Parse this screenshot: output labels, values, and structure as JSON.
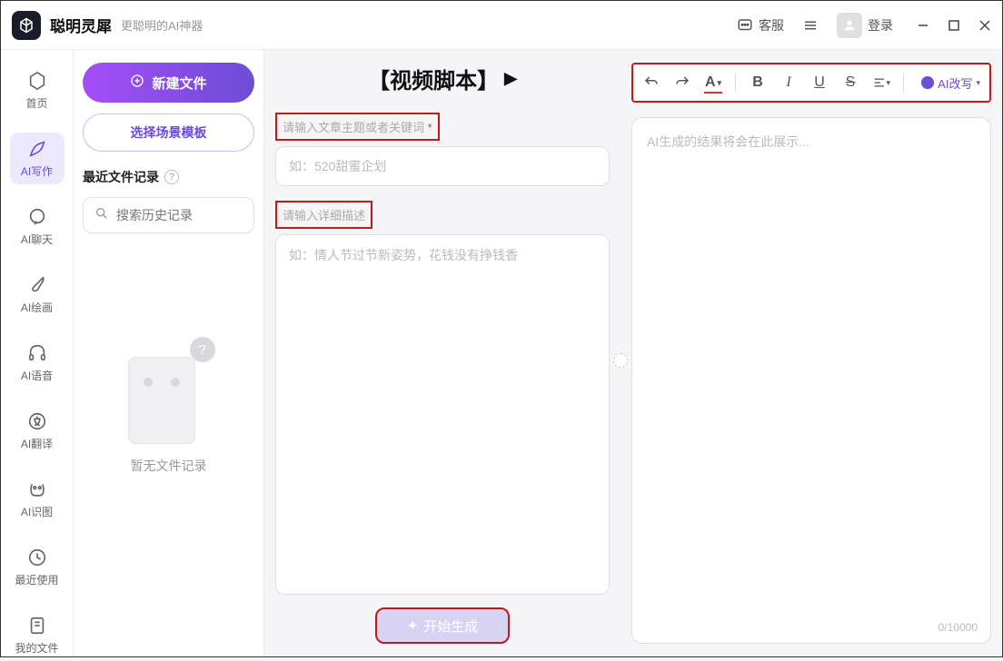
{
  "titlebar": {
    "app_name": "聪明灵犀",
    "app_subtitle": "更聪明的AI神器",
    "service_label": "客服",
    "login_label": "登录"
  },
  "sidebar": {
    "items": [
      {
        "label": "首页"
      },
      {
        "label": "AI写作"
      },
      {
        "label": "AI聊天"
      },
      {
        "label": "AI绘画"
      },
      {
        "label": "AI语音"
      },
      {
        "label": "AI翻译"
      },
      {
        "label": "AI识图"
      },
      {
        "label": "最近使用"
      },
      {
        "label": "我的文件"
      }
    ]
  },
  "leftpanel": {
    "new_file": "新建文件",
    "choose_template": "选择场景模板",
    "recent_title": "最近文件记录",
    "search_placeholder": "搜索历史记录",
    "empty_text": "暂无文件记录"
  },
  "center": {
    "title": "【视频脚本】",
    "topic_label": "请输入文章主题或者关键词",
    "topic_placeholder": "如：520甜蜜企划",
    "desc_label": "请输入详细描述",
    "desc_placeholder": "如：情人节过节新姿势，花钱没有挣钱香",
    "generate": "开始生成"
  },
  "right": {
    "ai_rewrite": "AI改写",
    "output_placeholder": "AI生成的结果将会在此展示...",
    "counter": "0/10000"
  }
}
